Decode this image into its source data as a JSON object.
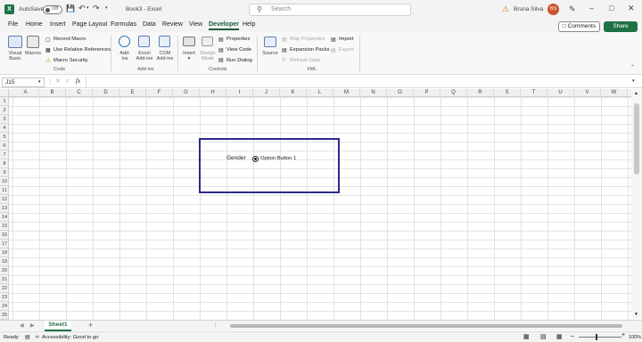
{
  "titlebar": {
    "autosave_label": "AutoSave",
    "autosave_state": "Off",
    "doc_title": "Book3 - Excel",
    "search_placeholder": "Search",
    "user_name": "Bruna Silva",
    "user_initials": "BS"
  },
  "menu": [
    "File",
    "Home",
    "Insert",
    "Page Layout",
    "Formulas",
    "Data",
    "Review",
    "View",
    "Developer",
    "Help"
  ],
  "active_menu": "Developer",
  "buttons": {
    "comments": "Comments",
    "share": "Share"
  },
  "ribbon": {
    "code": {
      "visual_basic": [
        "Visual",
        "Basic"
      ],
      "macros": "Macros",
      "record_macro": "Record Macro",
      "use_relative": "Use Relative References",
      "macro_security": "Macro Security",
      "group": "Code"
    },
    "addins": {
      "addins": [
        "Add-",
        "ins"
      ],
      "excel_addins": [
        "Excel",
        "Add-ins"
      ],
      "com_addins": [
        "COM",
        "Add-ins"
      ],
      "group": "Add-ins"
    },
    "controls": {
      "insert": "Insert",
      "design_mode": [
        "Design",
        "Mode"
      ],
      "properties": "Properties",
      "view_code": "View Code",
      "run_dialog": "Run Dialog",
      "group": "Controls"
    },
    "xml": {
      "source": "Source",
      "map_properties": "Map Properties",
      "expansion_packs": "Expansion Packs",
      "refresh_data": "Refresh Data",
      "import": "Import",
      "export": "Export",
      "group": "XML"
    }
  },
  "formula_bar": {
    "name_box": "J15",
    "fx": "fx"
  },
  "columns": [
    "A",
    "B",
    "C",
    "D",
    "E",
    "F",
    "G",
    "H",
    "I",
    "J",
    "K",
    "L",
    "M",
    "N",
    "O",
    "P",
    "Q",
    "R",
    "S",
    "T",
    "U",
    "V",
    "W"
  ],
  "rows": [
    "1",
    "2",
    "3",
    "4",
    "5",
    "6",
    "7",
    "8",
    "9",
    "10",
    "11",
    "12",
    "13",
    "14",
    "15",
    "16",
    "17",
    "18",
    "19",
    "20",
    "21",
    "22",
    "23",
    "24",
    "25"
  ],
  "form": {
    "gender_label": "Gender",
    "option_label": "Option Button 1",
    "selected": true
  },
  "sheet_tabs": [
    "Sheet1"
  ],
  "status": {
    "ready": "Ready",
    "accessibility": "Accessibility: Good to go",
    "zoom": "100%"
  }
}
